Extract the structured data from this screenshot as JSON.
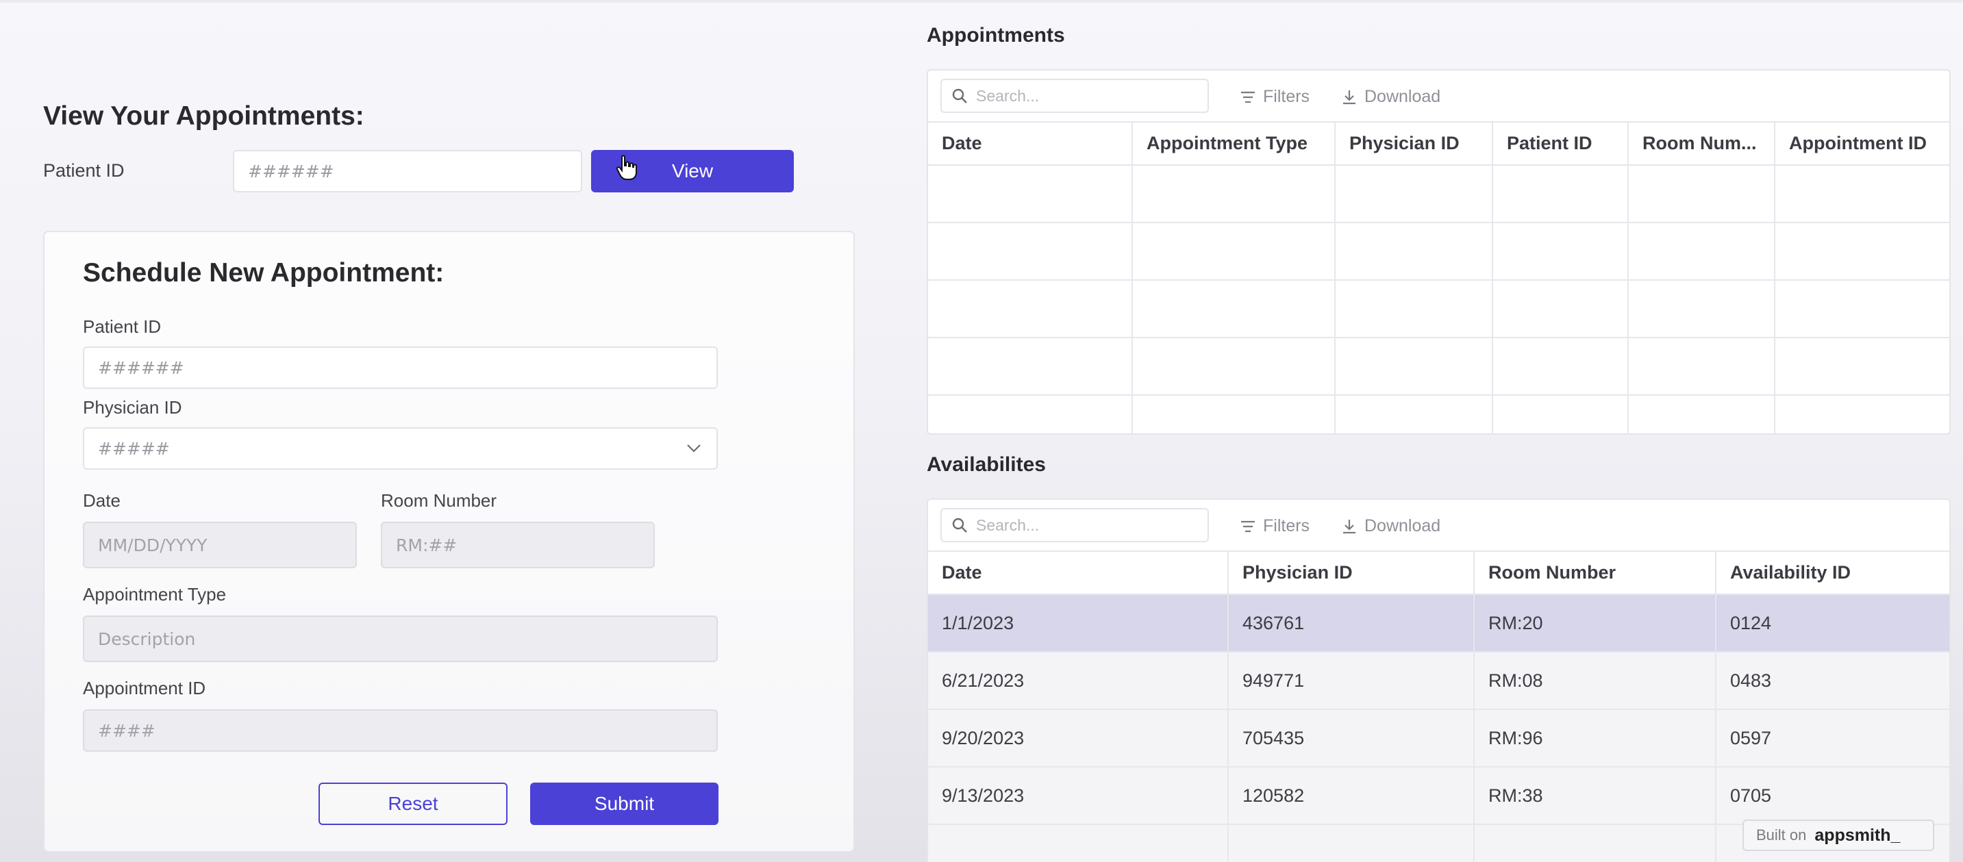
{
  "view_section": {
    "title": "View Your Appointments:",
    "patient_id_label": "Patient ID",
    "patient_id_placeholder": "######",
    "view_button": "View"
  },
  "schedule_form": {
    "title": "Schedule New Appointment:",
    "patient_id_label": "Patient ID",
    "patient_id_placeholder": "######",
    "physician_id_label": "Physician ID",
    "physician_id_placeholder": "#####",
    "date_label": "Date",
    "date_placeholder": "MM/DD/YYYY",
    "room_label": "Room Number",
    "room_placeholder": "RM:##",
    "type_label": "Appointment Type",
    "type_placeholder": "Description",
    "appt_id_label": "Appointment ID",
    "appt_id_placeholder": "####",
    "reset_button": "Reset",
    "submit_button": "Submit"
  },
  "appointments_table": {
    "title": "Appointments",
    "search_placeholder": "Search...",
    "filters_label": "Filters",
    "download_label": "Download",
    "columns": [
      "Date",
      "Appointment Type",
      "Physician ID",
      "Patient ID",
      "Room Num...",
      "Appointment ID"
    ]
  },
  "availabilities_table": {
    "title": "Availabilites",
    "search_placeholder": "Search...",
    "filters_label": "Filters",
    "download_label": "Download",
    "columns": [
      "Date",
      "Physician ID",
      "Room Number",
      "Availability ID"
    ],
    "rows": [
      [
        "1/1/2023",
        "436761",
        "RM:20",
        "0124"
      ],
      [
        "6/21/2023",
        "949771",
        "RM:08",
        "0483"
      ],
      [
        "9/20/2023",
        "705435",
        "RM:96",
        "0597"
      ],
      [
        "9/13/2023",
        "120582",
        "RM:38",
        "0705"
      ]
    ]
  },
  "footer": {
    "built_on": "Built on",
    "brand": "appsmith_"
  },
  "colors": {
    "accent": "#4b41d6",
    "selected_row": "#d7d6ea"
  }
}
